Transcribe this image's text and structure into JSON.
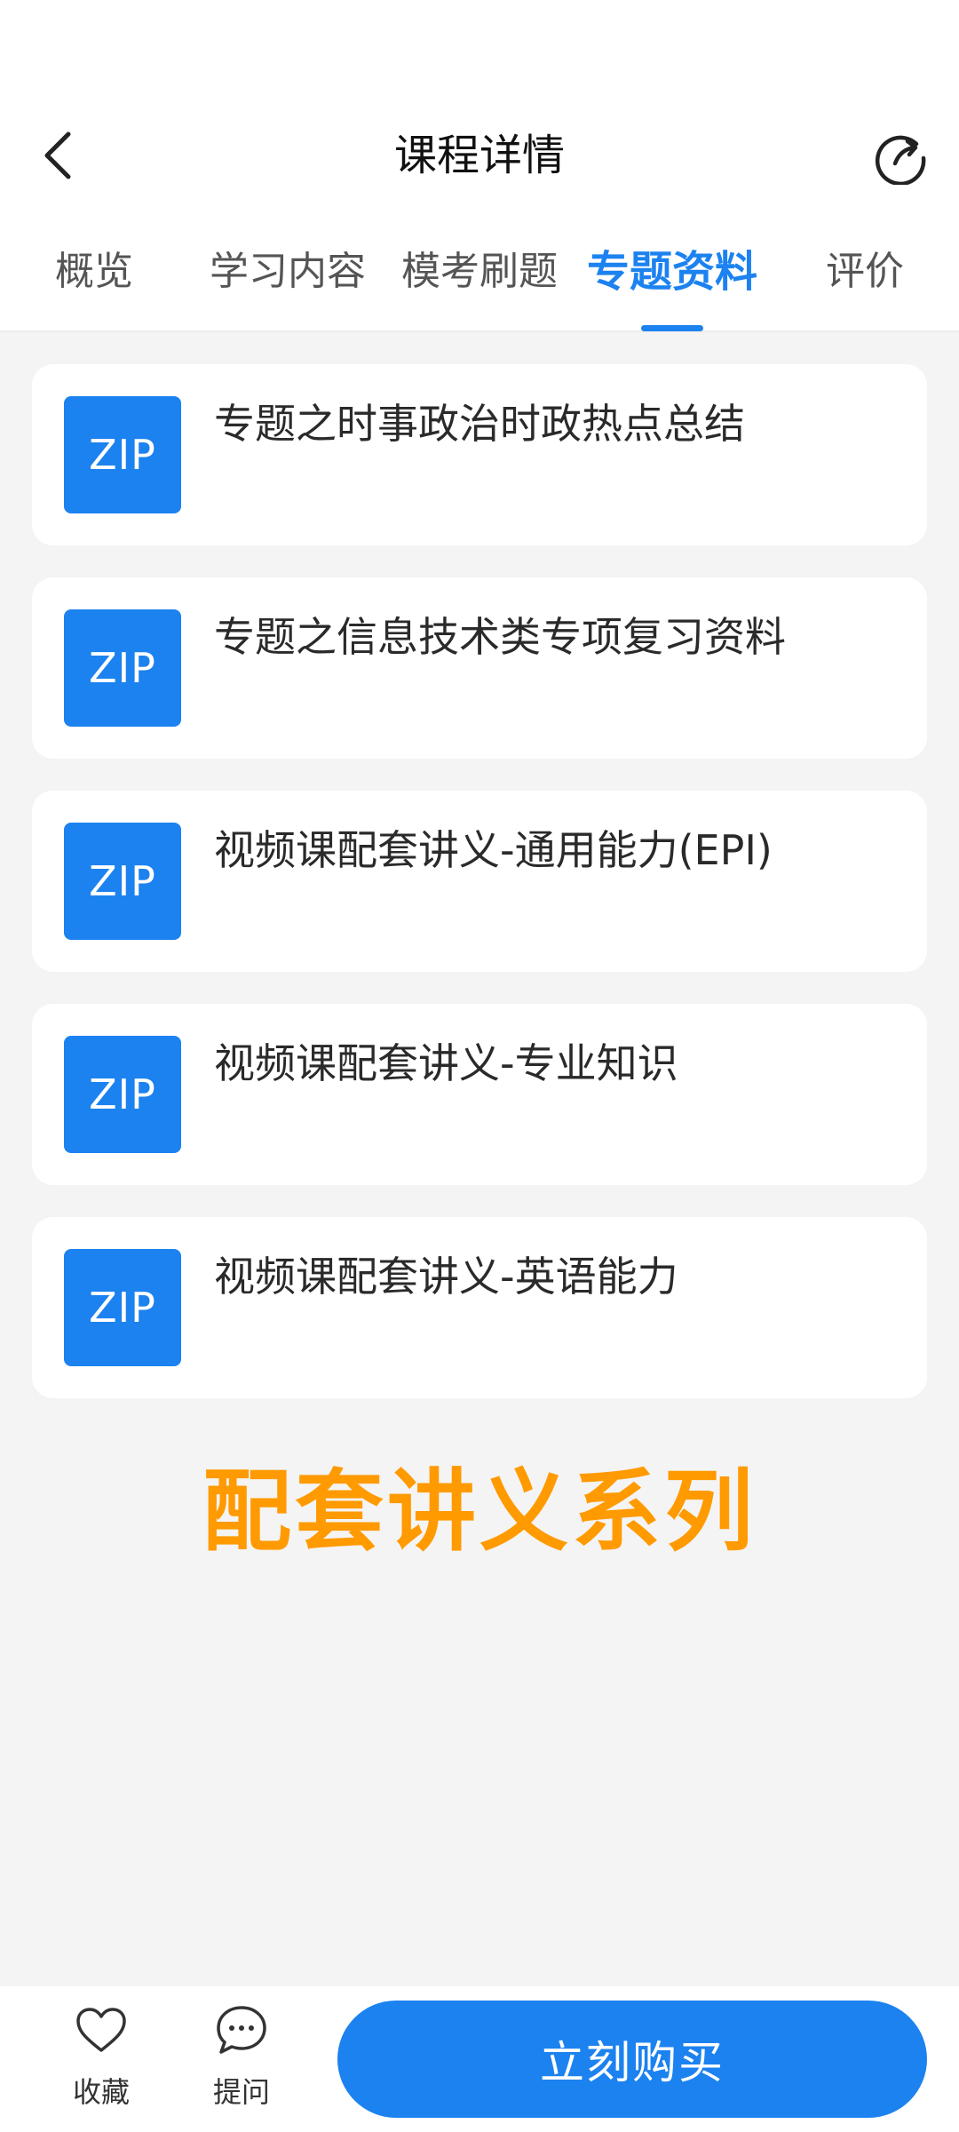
{
  "header": {
    "title": "课程详情",
    "back_icon": "chevron-left-icon",
    "share_icon": "share-icon"
  },
  "tabs": [
    {
      "label": "概览",
      "active": false
    },
    {
      "label": "学习内容",
      "active": false
    },
    {
      "label": "模考刷题",
      "active": false
    },
    {
      "label": "专题资料",
      "active": true
    },
    {
      "label": "评价",
      "active": false
    }
  ],
  "materials": [
    {
      "badge": "ZIP",
      "title": "专题之时事政治时政热点总结"
    },
    {
      "badge": "ZIP",
      "title": "专题之信息技术类专项复习资料"
    },
    {
      "badge": "ZIP",
      "title": "视频课配套讲义-通用能力(EPI)"
    },
    {
      "badge": "ZIP",
      "title": "视频课配套讲义-专业知识"
    },
    {
      "badge": "ZIP",
      "title": "视频课配套讲义-英语能力"
    }
  ],
  "promo_text": "配套讲义系列",
  "bottom_bar": {
    "favorite_label": "收藏",
    "favorite_icon": "heart-icon",
    "ask_label": "提问",
    "ask_icon": "chat-bubble-icon",
    "buy_label": "立刻购买"
  },
  "colors": {
    "accent": "#1c82f0",
    "promo": "#ff9a00",
    "background": "#f4f4f4"
  }
}
